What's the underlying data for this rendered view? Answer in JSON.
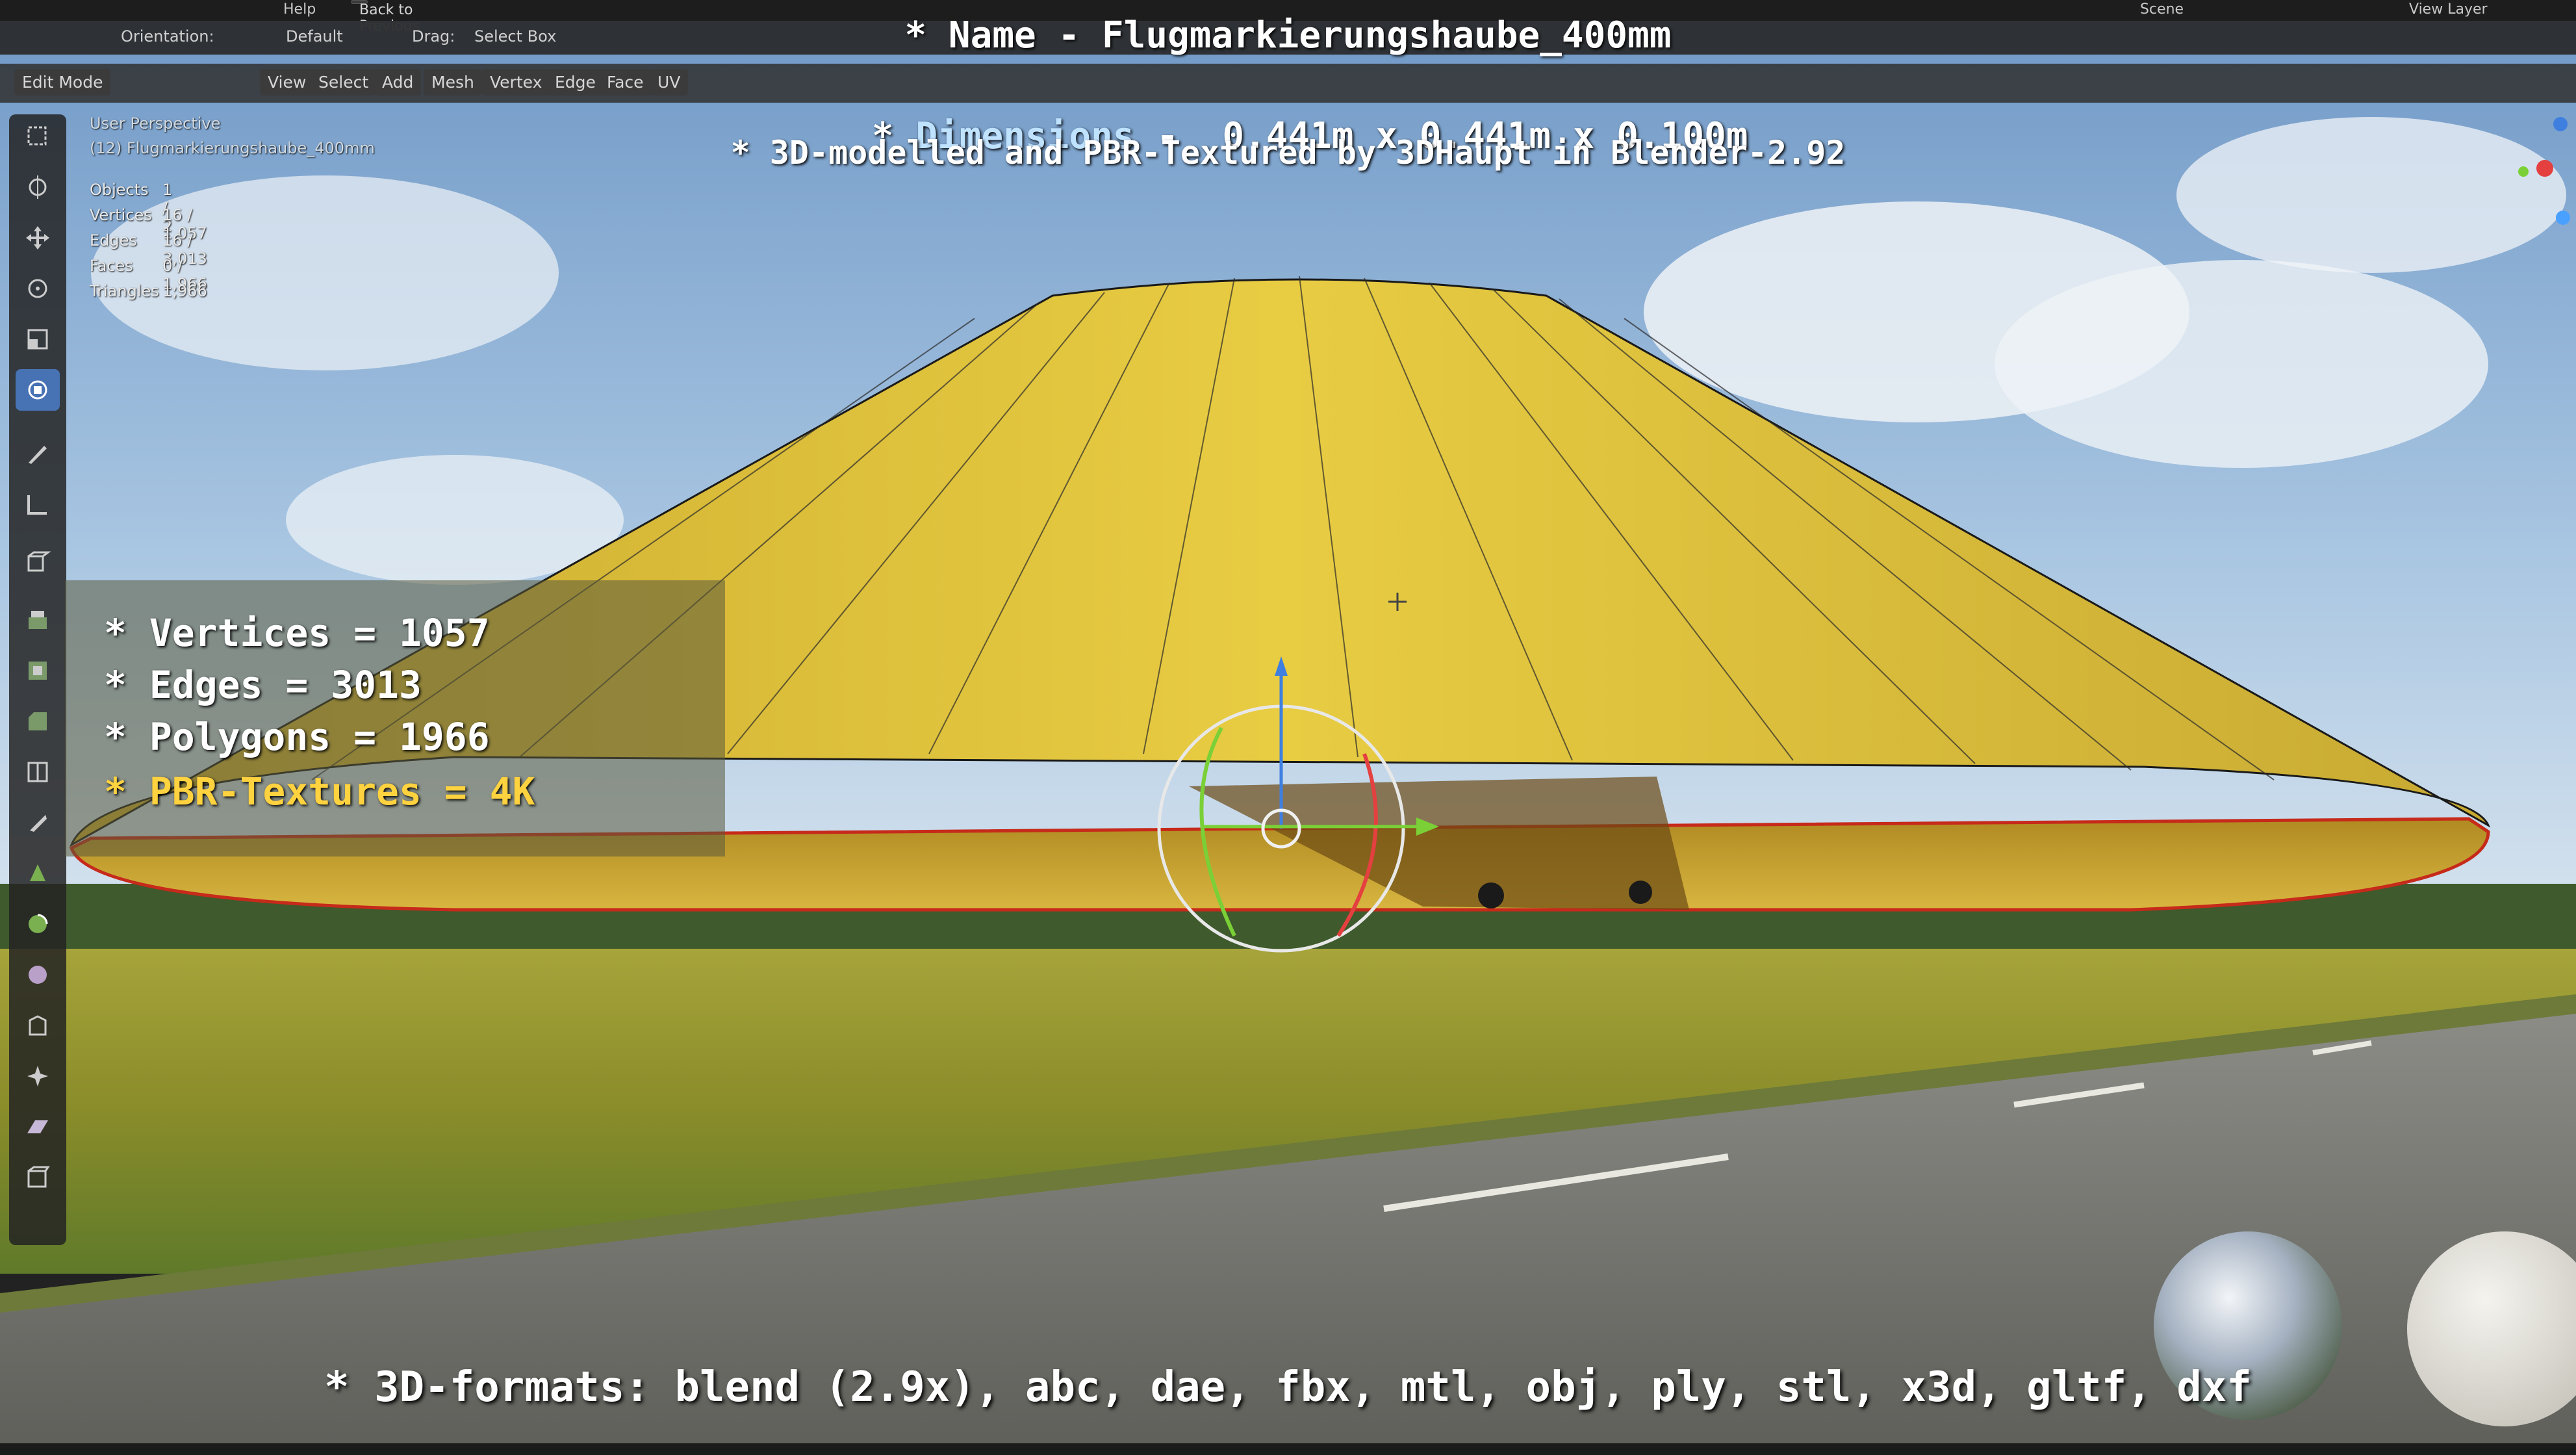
{
  "topbar": {
    "help_menu": "Help",
    "back_button": "Back to Previous",
    "scene_label": "Scene",
    "view_layer_label": "View Layer"
  },
  "header": {
    "orientation_label": "Orientation:",
    "orientation_value": "Default",
    "drag_label": "Drag:",
    "drag_value": "Select Box"
  },
  "viewport_header": {
    "mode": "Edit Mode",
    "menus": [
      "View",
      "Select",
      "Add",
      "Mesh",
      "Vertex",
      "Edge",
      "Face",
      "UV"
    ]
  },
  "viewport_info": {
    "perspective": "User Perspective",
    "object": "(12) Flugmarkierungshaube_400mm",
    "stats": [
      {
        "label": "Objects",
        "value": "1 / 2"
      },
      {
        "label": "Vertices",
        "value": "16 / 1,057"
      },
      {
        "label": "Edges",
        "value": "16 / 3,013"
      },
      {
        "label": "Faces",
        "value": "0 / 1,966"
      },
      {
        "label": "Triangles",
        "value": "1,966"
      }
    ]
  },
  "title_overlay": {
    "name_line": "* Name - Flugmarkierungshaube_400mm",
    "dimensions_prefix": "* ",
    "dimensions_label": "Dimensions",
    "dimensions_value": " -  0.441m x 0.441m x 0.100m",
    "credit_line": "* 3D-modelled and PBR-Textured by 3DHaupt in Blender-2.92"
  },
  "specs_overlay": {
    "vertices": "* Vertices = 1057",
    "edges": "* Edges = 3013",
    "polygons": "* Polygons = 1966",
    "textures": "* PBR-Textures = 4K"
  },
  "formats_line": "* 3D-formats: blend (2.9x), abc, dae, fbx, mtl, obj, ply, stl, x3d, gltf, dxf",
  "colors": {
    "dimensions_label": "#bfe2ff",
    "textures_line": "#ffd23f",
    "active_tool": "#4772b3",
    "cone": "#e0c63a",
    "sky": "#8fb4d8"
  },
  "icons": [
    "select-box-icon",
    "cursor-icon",
    "move-icon",
    "rotate-icon",
    "scale-icon",
    "transform-icon",
    "annotate-icon",
    "measure-icon",
    "add-cube-icon",
    "extrude-icon",
    "inset-icon",
    "bevel-icon",
    "loop-cut-icon",
    "knife-icon",
    "poly-build-icon",
    "spin-icon",
    "smooth-icon",
    "edge-slide-icon",
    "shrink-fatten-icon",
    "shear-icon",
    "rip-icon"
  ]
}
